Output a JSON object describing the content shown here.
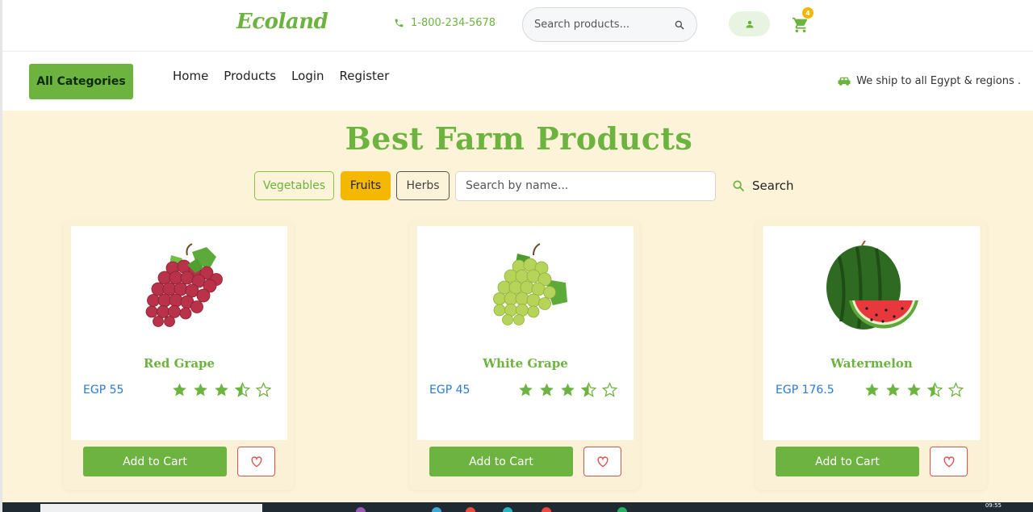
{
  "header": {
    "logo": "Ecoland",
    "phone": "1-800-234-5678",
    "search_placeholder": "Search products...",
    "cart_count": "4",
    "icons": {
      "phone": "phone-icon",
      "search": "search-icon",
      "user": "user-icon",
      "cart": "cart-icon"
    }
  },
  "nav": {
    "all_categories": "All Categories",
    "links": [
      "Home",
      "Products",
      "Login",
      "Register"
    ],
    "shipping_text": "We ship to all Egypt & regions ."
  },
  "main": {
    "heading": "Best Farm Products",
    "filters": [
      "Vegetables",
      "Fruits",
      "Herbs"
    ],
    "active_filter": "Fruits",
    "name_search_placeholder": "Search by name...",
    "search_label": "Search"
  },
  "products": [
    {
      "name": "Red Grape",
      "price": "EGP 55",
      "rating": 3.5,
      "add_label": "Add to Cart"
    },
    {
      "name": "White Grape",
      "price": "EGP 45",
      "rating": 3.5,
      "add_label": "Add to Cart"
    },
    {
      "name": "Watermelon",
      "price": "EGP 176.5",
      "rating": 3.5,
      "add_label": "Add to Cart"
    }
  ],
  "colors": {
    "brand_green": "#6db33f",
    "cream": "#fdf3d8",
    "price_blue": "#2a7ad8",
    "active_yellow": "#f5b800",
    "fav_red": "#d9534f"
  },
  "taskbar": {
    "time": "09:55"
  }
}
